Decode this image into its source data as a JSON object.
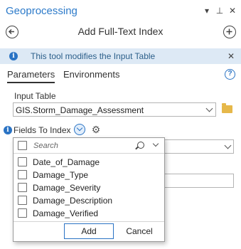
{
  "pane": {
    "title": "Geoprocessing",
    "controls": {
      "options": "▾",
      "pin": "⊥",
      "close": "✕"
    }
  },
  "header": {
    "tool_title": "Add Full-Text Index",
    "back_label": "",
    "add_label": ""
  },
  "info_bar": {
    "message": "This tool modifies the Input Table",
    "icon": "i",
    "close": "✕"
  },
  "tabs": [
    {
      "label": "Parameters",
      "active": true
    },
    {
      "label": "Environments",
      "active": false
    }
  ],
  "help": "?",
  "input_table": {
    "label": "Input Table",
    "value": "GIS.Storm_Damage_Assessment"
  },
  "fields_to_index": {
    "label": "Fields To Index",
    "info_icon": "i",
    "gear_icon": "⚙"
  },
  "dropdown": {
    "search_placeholder": "Search",
    "items": [
      {
        "label": "Date_of_Damage",
        "checked": false
      },
      {
        "label": "Damage_Type",
        "checked": false
      },
      {
        "label": "Damage_Severity",
        "checked": false
      },
      {
        "label": "Damage_Description",
        "checked": false
      },
      {
        "label": "Damage_Verified",
        "checked": false
      }
    ],
    "add_label": "Add",
    "cancel_label": "Cancel"
  },
  "colors": {
    "accent": "#2a73c4",
    "title": "#2c7ac9",
    "info_bar_bg": "#dde9f5",
    "folder": "#e6b84a"
  }
}
